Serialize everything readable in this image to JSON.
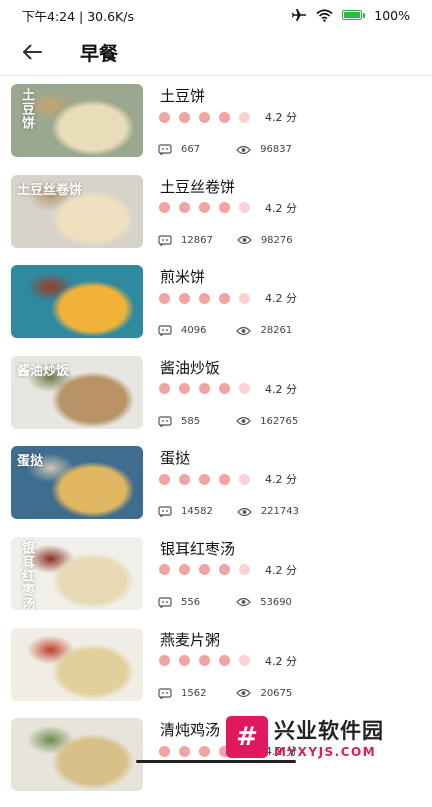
{
  "status_bar": {
    "time_speed": "下午4:24 | 30.6K/s",
    "battery": "100%",
    "icons": [
      "airplane-icon",
      "wifi-icon",
      "battery-icon"
    ]
  },
  "header": {
    "back_icon": "arrow-left-icon",
    "title": "早餐"
  },
  "rating_dots_filled": 4,
  "rating_dots_total": 5,
  "stat_icons": [
    "comment-icon",
    "eye-icon"
  ],
  "items": [
    {
      "title": "土豆饼",
      "rating": "4.2 分",
      "comments": "667",
      "views": "96837",
      "thumb_text": "土豆饼",
      "thumb_colors": [
        "#9aa88f",
        "#e9dcb8",
        "#c7a56a"
      ]
    },
    {
      "title": "土豆丝卷饼",
      "rating": "4.2 分",
      "comments": "12867",
      "views": "98276",
      "thumb_text": "土豆丝卷饼",
      "thumb_colors": [
        "#d7d3cb",
        "#efe0bf",
        "#b9a07a"
      ]
    },
    {
      "title": "煎米饼",
      "rating": "4.2 分",
      "comments": "4096",
      "views": "28261",
      "thumb_text": "",
      "thumb_colors": [
        "#2f8aa0",
        "#f1b23a",
        "#9c3a23"
      ]
    },
    {
      "title": "酱油炒饭",
      "rating": "4.2 分",
      "comments": "585",
      "views": "162765",
      "thumb_text": "酱油炒饭",
      "thumb_colors": [
        "#e8e6e1",
        "#b79367",
        "#6f7d4a"
      ]
    },
    {
      "title": "蛋挞",
      "rating": "4.2 分",
      "comments": "14582",
      "views": "221743",
      "thumb_text": "蛋挞",
      "thumb_colors": [
        "#3f6d8f",
        "#e0b760",
        "#cfc7b5"
      ]
    },
    {
      "title": "银耳红枣汤",
      "rating": "4.2 分",
      "comments": "556",
      "views": "53690",
      "thumb_text": "银耳红枣汤",
      "thumb_colors": [
        "#f1efe9",
        "#e6d9b4",
        "#8a2f22"
      ]
    },
    {
      "title": "燕麦片粥",
      "rating": "4.2 分",
      "comments": "1562",
      "views": "20675",
      "thumb_text": "",
      "thumb_colors": [
        "#f0ede4",
        "#e3cf9a",
        "#c0402b"
      ]
    },
    {
      "title": "清炖鸡汤",
      "rating": "4.2 分",
      "comments": "",
      "views": "",
      "thumb_text": "",
      "thumb_colors": [
        "#e7e4dc",
        "#d8c089",
        "#6f8a4a"
      ]
    }
  ],
  "watermark": {
    "logo_glyph": "#",
    "cn": "兴业软件园",
    "en": "MYXYJS.COM"
  }
}
